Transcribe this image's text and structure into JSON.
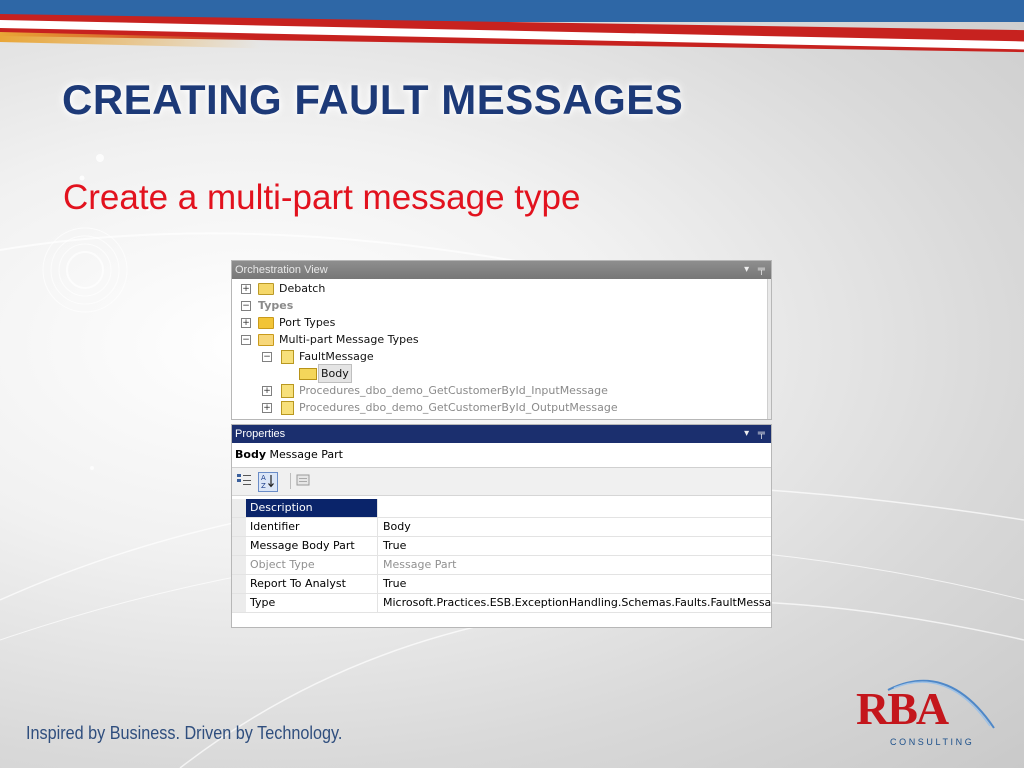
{
  "slide": {
    "title": "CREATING FAULT MESSAGES",
    "subtitle": "Create a multi-part message type",
    "footer_tagline": "Inspired by Business. Driven by Technology.",
    "logo": {
      "brand": "RBA",
      "subtitle": "CONSULTING"
    }
  },
  "colors": {
    "title": "#1d3a78",
    "subtitle": "#e2121e",
    "top_stripe_blue": "#2e67a6",
    "top_stripe_red": "#c7221f",
    "properties_header": "#1b2f6e",
    "logo_red": "#c4161c"
  },
  "orchestration_view": {
    "title": "Orchestration View",
    "controls": [
      "▾",
      "╤"
    ],
    "tree": [
      {
        "label": "Debatch",
        "icon": "orchestration-icon",
        "expander": "+"
      },
      {
        "label": "Types",
        "icon": "none",
        "expander": "−"
      },
      {
        "label": "Port Types",
        "icon": "folder-icon",
        "expander": "+"
      },
      {
        "label": "Multi-part Message Types",
        "icon": "open-folder-icon",
        "expander": "−"
      },
      {
        "label": "FaultMessage",
        "icon": "message-type-icon",
        "expander": "−"
      },
      {
        "label": "Body",
        "icon": "message-part-icon",
        "expander": ""
      },
      {
        "label": "Procedures_dbo_demo_GetCustomerById_InputMessage",
        "icon": "message-type-icon",
        "expander": "+"
      },
      {
        "label": "Procedures_dbo_demo_GetCustomerById_OutputMessage",
        "icon": "message-type-icon",
        "expander": "+"
      }
    ]
  },
  "properties": {
    "title": "Properties",
    "controls": [
      "▾",
      "╤"
    ],
    "object_name": "Body",
    "object_type": "Message Part",
    "toolbar": [
      "categorized-icon",
      "alphabetical-icon",
      "property-pages-icon"
    ],
    "rows": [
      {
        "name": "Description",
        "value": ""
      },
      {
        "name": "Identifier",
        "value": "Body"
      },
      {
        "name": "Message Body Part",
        "value": "True"
      },
      {
        "name": "Object Type",
        "value": "Message Part"
      },
      {
        "name": "Report To Analyst",
        "value": "True"
      },
      {
        "name": "Type",
        "value": "Microsoft.Practices.ESB.ExceptionHandling.Schemas.Faults.FaultMessage"
      }
    ]
  }
}
